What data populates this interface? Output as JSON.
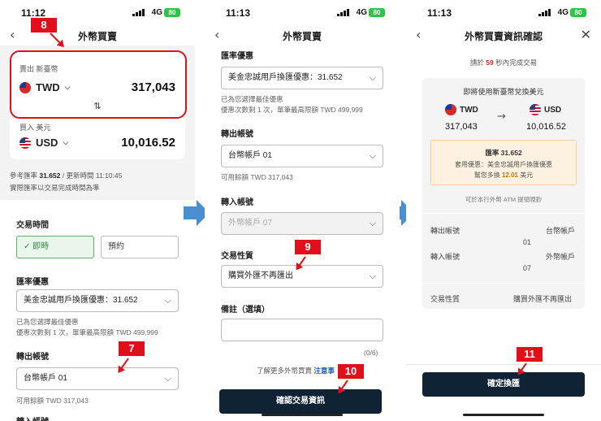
{
  "status": {
    "time_1": "11:12",
    "time_2": "11:13",
    "time_3": "11:13",
    "network": "4G",
    "battery": "80"
  },
  "screen1": {
    "title": "外幣買賣",
    "sell_label": "賣出 新臺幣",
    "sell_currency": "TWD",
    "sell_amount": "317,043",
    "buy_label": "買入 美元",
    "buy_currency": "USD",
    "buy_amount": "10,016.52",
    "rate_line_prefix": "參考匯率",
    "rate_value": "31.652",
    "rate_line_suffix": "/ 更新時間 11:10:45",
    "rate_note": "實際匯率以交易完成時間為準",
    "trade_time_label": "交易時間",
    "opt_now": "即時",
    "opt_reserve": "預約",
    "discount_label": "匯率優惠",
    "discount_value": "美金忠誠用戶換匯優惠：31.652",
    "discount_note1": "已為您選擇最佳優惠",
    "discount_note2": "優惠次數剩 1 次，單筆最高限額 TWD 499,999",
    "out_account_label": "轉出帳號",
    "out_account_value": "台幣帳戶 01",
    "available": "可用餘額 TWD 317,043",
    "in_account_label": "轉入帳號"
  },
  "screen2": {
    "title": "外幣買賣",
    "discount_label": "匯率優惠",
    "discount_value": "美金忠誠用戶換匯優惠：31.652",
    "discount_note1": "已為您選擇最佳優惠",
    "discount_note2": "優惠次數剩 1 次，單筆最高限額 TWD 499,999",
    "out_account_label": "轉出帳號",
    "out_account_value": "台幣帳戶 01",
    "available": "可用餘額 TWD 317,043",
    "in_account_label": "轉入帳號",
    "in_account_value": "外幣帳戶 07",
    "nature_label": "交易性質",
    "nature_value": "購買外匯不再匯出",
    "memo_label": "備註（選填）",
    "memo_counter": "(0/6)",
    "learn_more_prefix": "了解更多外幣買賣",
    "learn_more_link": "注意事",
    "confirm_button": "確認交易資訊"
  },
  "screen3": {
    "title": "外幣買賣資訊確認",
    "countdown_prefix": "請於",
    "countdown_value": "59",
    "countdown_suffix": "秒內完成交易",
    "headline": "即將使用新臺幣兌換美元",
    "from_currency": "TWD",
    "from_amount": "317,043",
    "to_currency": "USD",
    "to_amount": "10,016.52",
    "notice_rate": "匯率 31.652",
    "notice_line1": "套用優惠：美金忠誠用戶換匯優惠",
    "notice_line2_prefix": "幫您多換",
    "notice_line2_value": "12.01",
    "notice_line2_suffix": "美元",
    "atm_note": "可於本行外幣 ATM 提領現鈔",
    "out_label": "轉出帳號",
    "out_value1": "台幣帳戶",
    "out_value2": "01",
    "in_label": "轉入帳號",
    "in_value1": "外幣帳戶",
    "in_value2": "07",
    "nature_label": "交易性質",
    "nature_value": "購買外匯不再匯出",
    "confirm_button": "確定換匯"
  },
  "steps": {
    "s8": "8",
    "s7": "7",
    "s9": "9",
    "s10": "10",
    "s11": "11"
  },
  "colors": {
    "accent_red": "#e0101a",
    "button_dark": "#0f2334",
    "arrow_blue": "#4a8ed1",
    "countdown_red": "#d62828",
    "link_blue": "#1a5fb4"
  }
}
